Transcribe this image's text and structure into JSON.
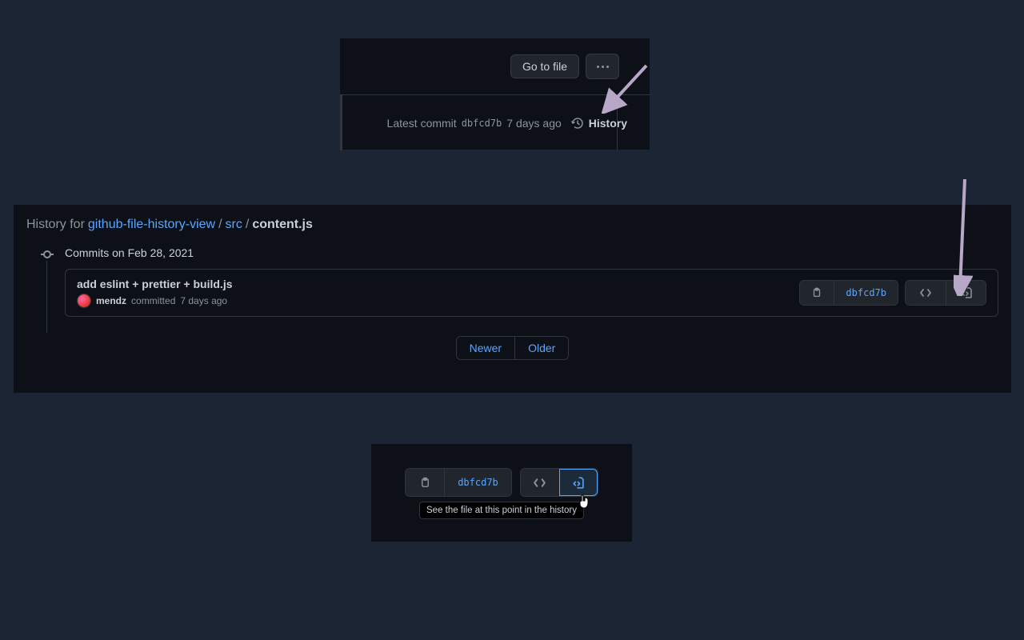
{
  "panel1": {
    "go_to_file": "Go to file",
    "latest_commit": "Latest commit",
    "sha": "dbfcd7b",
    "time": "7 days ago",
    "history_label": "History"
  },
  "breadcrumb": {
    "prefix": "History for",
    "repo": "github-file-history-view",
    "src": "src",
    "file": "content.js"
  },
  "commits": {
    "date_label": "Commits on Feb 28, 2021",
    "items": [
      {
        "message": "add eslint + prettier + build.js",
        "author": "mendz",
        "committed": "committed",
        "time": "7 days ago",
        "sha": "dbfcd7b"
      }
    ]
  },
  "pager": {
    "newer": "Newer",
    "older": "Older"
  },
  "zoom": {
    "sha": "dbfcd7b",
    "tooltip": "See the file at this point in the history"
  }
}
